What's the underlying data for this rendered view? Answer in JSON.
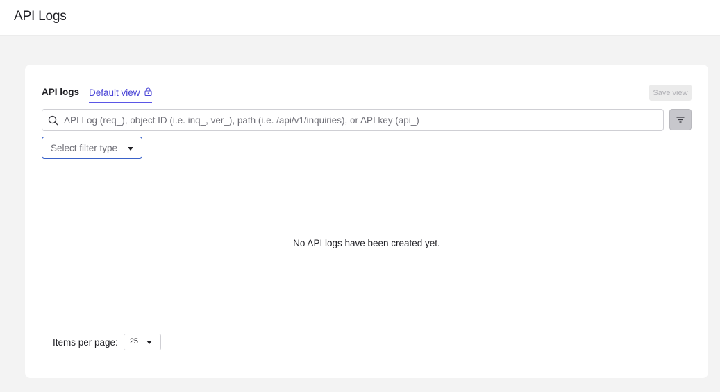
{
  "header": {
    "title": "API Logs"
  },
  "tabs": {
    "api_logs_label": "API logs",
    "default_view_label": "Default view",
    "save_view_label": "Save view"
  },
  "search": {
    "placeholder": "API Log (req_), object ID (i.e. inq_, ver_), path (i.e. /api/v1/inquiries), or API key (api_)",
    "value": ""
  },
  "filter": {
    "select_label": "Select filter type"
  },
  "empty_state": {
    "message": "No API logs have been created yet."
  },
  "pagination": {
    "items_per_page_label": "Items per page:",
    "items_per_page_value": "25"
  },
  "colors": {
    "accent": "#5b56e6",
    "link": "#4a45d6",
    "focus_border": "#3a62c9"
  },
  "icons": {
    "search": "search-icon",
    "lock": "lock-icon",
    "filter": "filter-lines-icon",
    "caret": "caret-down-icon"
  }
}
